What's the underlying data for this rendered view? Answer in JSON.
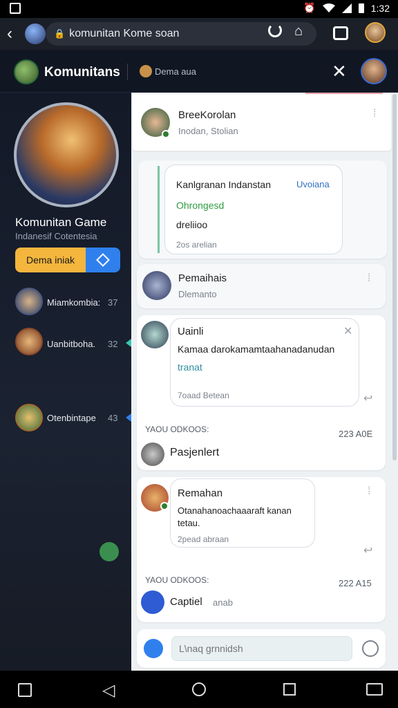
{
  "status_bar": {
    "time": "1:32",
    "icons": [
      "alarm-icon",
      "wifi-icon",
      "signal-icon",
      "battery-icon"
    ]
  },
  "browser": {
    "url": "komunitan Kome soan",
    "lock_icon": "lock-icon"
  },
  "header": {
    "title": "Komunitans",
    "chat_name": "Dema aua"
  },
  "sidebar": {
    "group_name": "Komunitan Game",
    "group_sub": "Indanesif Cotentesia",
    "join_button": "Dema iniak",
    "members": [
      {
        "name": "Miamkombia:",
        "count": "37"
      },
      {
        "name": "Uanbitboha.",
        "count": "32"
      },
      {
        "name": "Otenbintape",
        "count": "43"
      }
    ]
  },
  "feed": {
    "post1": {
      "name": "BreeKorolan",
      "sub": "Inodan, Stolian"
    },
    "message1": {
      "line1": "Kanlgranan Indanstan",
      "tag1": "Uvoiana",
      "line2": "Ohrongesd",
      "line3": "dreliioo",
      "footer": "2os arelian"
    },
    "post2": {
      "name": "Pemaihais",
      "sub": "Dlemanto"
    },
    "message2": {
      "name": "Uainli",
      "text": "Kamaa darokamamtaahanadanudan",
      "text2": "tranat",
      "footer": "7oaad Betean"
    },
    "section1": {
      "label": "YAOU ODKOOS:",
      "time": "223 A0E"
    },
    "reply1": "Pasjenlert",
    "post3": {
      "name": "Remahan",
      "text": "Otanahanoachaaaraft kanan",
      "text2": "tetau.",
      "footer": "2pead abraan"
    },
    "section2": {
      "label": "YAOU ODKOOS:",
      "time": "222 A15"
    },
    "reply2": "Captiel",
    "reply2_sub": "anab"
  },
  "composer": {
    "placeholder": "L\\naq grnnidsh"
  },
  "colors": {
    "accent": "#2f80ed",
    "join": "#f4b63d",
    "online": "#2e7d32"
  }
}
